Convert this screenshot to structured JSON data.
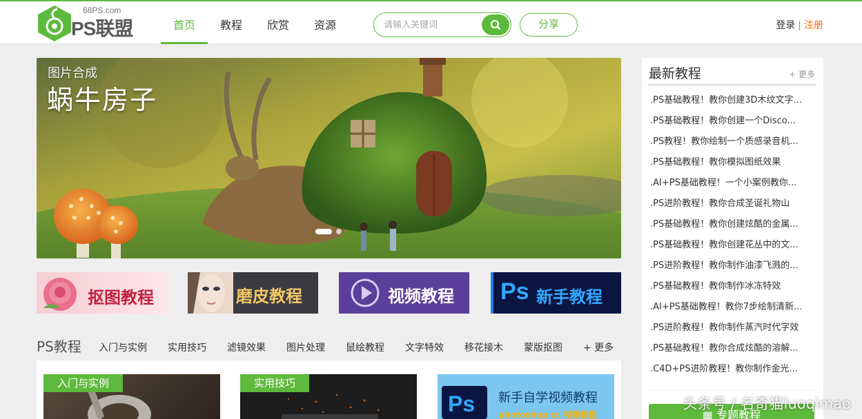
{
  "header": {
    "logo_site": "68PS.com",
    "logo_text": "PS联盟",
    "nav": [
      "首页",
      "教程",
      "欣赏",
      "资源"
    ],
    "active_nav": "首页",
    "search_placeholder": "请输入关键词",
    "share_label": "分享",
    "login_label": "登录",
    "separator": "|",
    "register_label": "注册"
  },
  "banner": {
    "subtitle": "图片合成",
    "title": "蜗牛房子",
    "slide_count": 2,
    "active_slide": 1
  },
  "categories": [
    {
      "label": "抠图教程",
      "icon": "rose-image"
    },
    {
      "label": "磨皮教程",
      "icon": "face-image"
    },
    {
      "label": "视频教程",
      "icon": "play-icon"
    },
    {
      "label": "新手教程",
      "badge": "Ps"
    }
  ],
  "ps_section": {
    "title": "PS教程",
    "tabs": [
      "入门与实例",
      "实用技巧",
      "滤镜效果",
      "图片处理",
      "鼠绘教程",
      "文字特效",
      "移花接木",
      "蒙版抠图"
    ],
    "more_label": "+ 更多",
    "cards": [
      {
        "tag": "入门与实例"
      },
      {
        "tag": "实用技巧"
      },
      {
        "badge": "Ps",
        "line1": "新手自学视频教程",
        "line2": "photoshop cc 视频教程"
      }
    ]
  },
  "sidebar": {
    "title": "最新教程",
    "more_label": "+ 更多",
    "items": [
      ".PS基础教程！教你创建3D木纹文字...",
      ".PS基础教程！教你创建一个Disco...",
      ".PS教程！教你绘制一个质感录音机...",
      ".PS基础教程！教你模拟图纸效果",
      ".AI+PS基础教程！一个小案例教你...",
      ".PS进阶教程！教你合成圣诞礼物山",
      ".PS基础教程！教你创建炫酷的金属...",
      ".PS基础教程！教你创建花丛中的文...",
      ".PS进阶教程！教你制作油漆飞溅的...",
      ".PS基础教程！教你制作冰冻特效",
      ".AI+PS基础教程！教你7步绘制清新...",
      ".PS进阶教程！教你制作蒸汽时代字效",
      ".PS基础教程！教你合成炫酷的溶解...",
      ".C4D+PS进阶教程！教你制作金光..."
    ],
    "topic_button": "专题教程"
  },
  "watermark": "头条号 / 名奇猫luoqimao",
  "colors": {
    "accent": "#5eba3c",
    "register": "#ff6600",
    "background": "#eeeeee"
  }
}
